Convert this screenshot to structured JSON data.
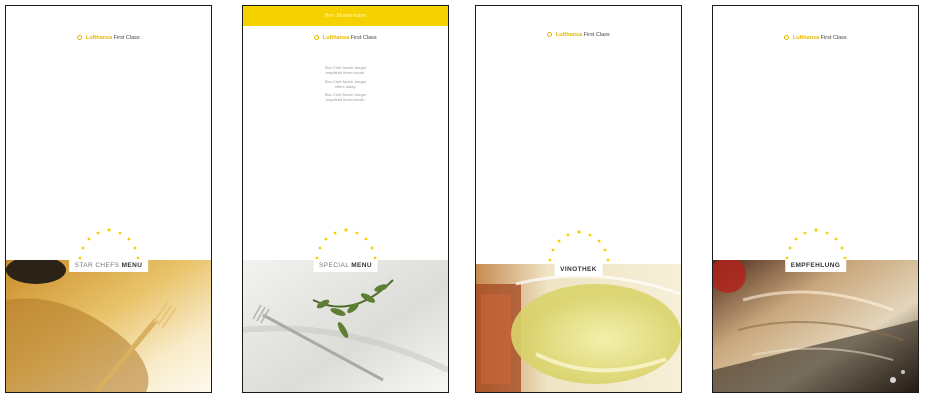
{
  "colors": {
    "accent_yellow": "#f6d100",
    "brand_yellow": "#e6b800",
    "border": "#1a1a1a"
  },
  "cards": [
    {
      "brand_name": "Lufthansa",
      "brand_class": "First Class",
      "label_light": "STAR CHEFS",
      "label_bold": "MENU",
      "photo": "golden plate with fork"
    },
    {
      "topbar_text": "Herr Mustermann",
      "brand_name": "Lufthansa",
      "brand_class": "First Class",
      "body_lines": [
        [
          "Star Chef André Jaeger",
          "empfiehlt Ihnen heute."
        ],
        [
          "Star Chef André Jaeger",
          "offers today."
        ],
        [
          "Star Chef André Jaeger",
          "empfiehlt Ihnen heute."
        ]
      ],
      "label_light": "SPECIAL",
      "label_bold": "MENU",
      "photo": "white napkin with fork and herb sprig"
    },
    {
      "brand_name": "Lufthansa",
      "brand_class": "First Class",
      "label_light": "",
      "label_bold": "VINOTHEK",
      "photo": "glasses of white and red wine"
    },
    {
      "brand_name": "Lufthansa",
      "brand_class": "First Class",
      "label_light": "",
      "label_bold": "EMPFEHLUNG",
      "photo": "wine bottle label"
    }
  ]
}
